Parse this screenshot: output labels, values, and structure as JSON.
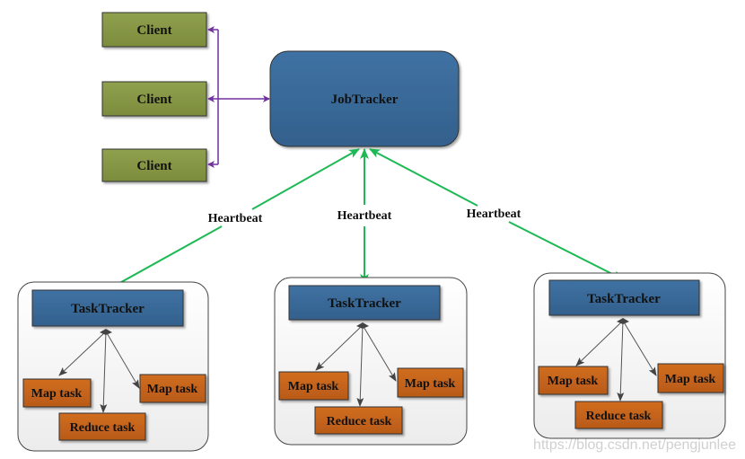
{
  "diagram": {
    "clients": [
      {
        "label": "Client"
      },
      {
        "label": "Client"
      },
      {
        "label": "Client"
      }
    ],
    "jobtracker": {
      "label": "JobTracker"
    },
    "heartbeat_labels": [
      "Heartbeat",
      "Heartbeat",
      "Heartbeat"
    ],
    "nodes": [
      {
        "tasktracker": "TaskTracker",
        "map1": "Map task",
        "map2": "Map task",
        "reduce": "Reduce task"
      },
      {
        "tasktracker": "TaskTracker",
        "map1": "Map task",
        "map2": "Map task",
        "reduce": "Reduce task"
      },
      {
        "tasktracker": "TaskTracker",
        "map1": "Map task",
        "map2": "Map task",
        "reduce": "Reduce task"
      }
    ],
    "colors": {
      "client_fill": "#8a9a48",
      "jobtracker_fill": "#3a6a9a",
      "tasktracker_fill": "#3a6a9a",
      "task_fill": "#c8641e",
      "client_arrow": "#7030a0",
      "heartbeat_arrow": "#1db954",
      "task_arrow": "#555555"
    },
    "watermark": "https://blog.csdn.net/pengjunlee"
  }
}
